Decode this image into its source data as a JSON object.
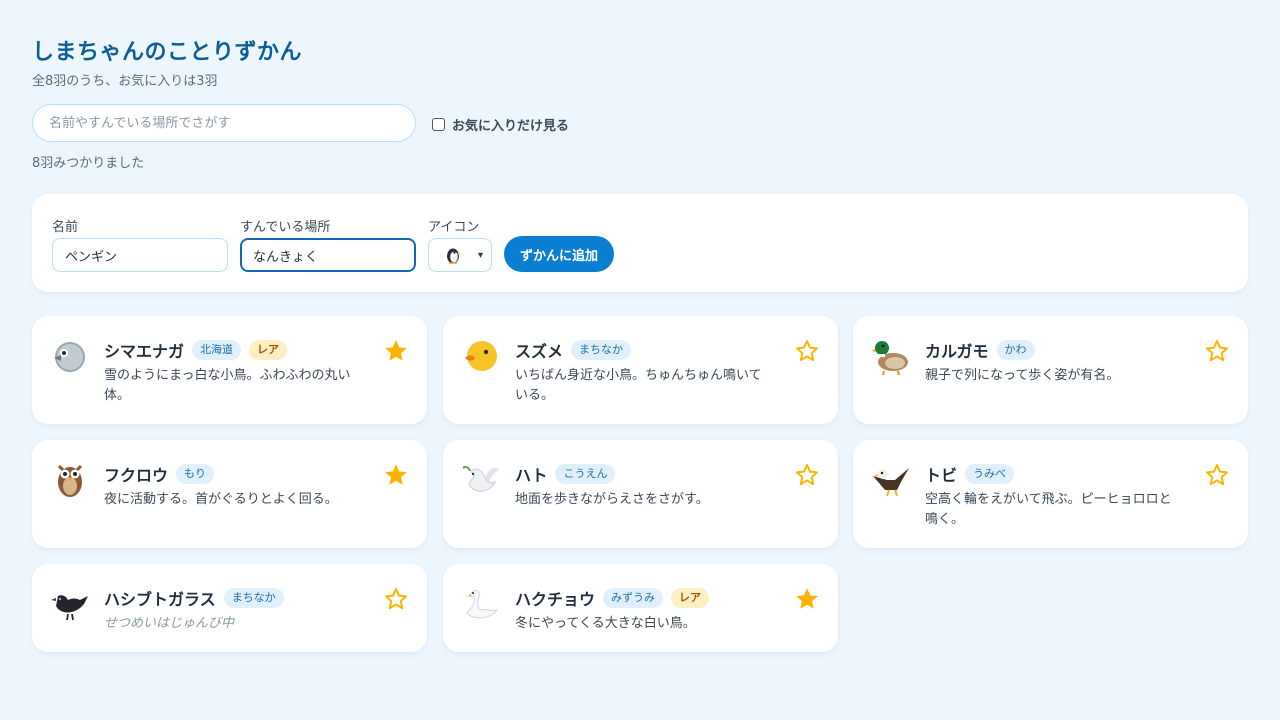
{
  "title": "しまちゃんのことりずかん",
  "subtitle": "全8羽のうち、お気に入りは3羽",
  "search": {
    "placeholder": "名前やすんでいる場所でさがす",
    "value": ""
  },
  "favorite_filter": {
    "label": "お気に入りだけ見る",
    "checked": false
  },
  "result_count": "8羽みつかりました",
  "form": {
    "name_label": "名前",
    "name_value": "ペンギン",
    "place_label": "すんでいる場所",
    "place_value": "なんきょく",
    "icon_label": "アイコン",
    "icon_selected": "penguin-icon",
    "add_button": "ずかんに追加"
  },
  "colors": {
    "accent": "#0a7fd1",
    "title": "#0b5f99",
    "star": "#ffb300",
    "background": "#eef6fd"
  },
  "cards": [
    {
      "icon": "bird-head-icon",
      "name": "シマエナガ",
      "place": "北海道",
      "rare": "レア",
      "desc": "雪のようにまっ白な小鳥。ふわふわの丸い体。",
      "favorite": true
    },
    {
      "icon": "chick-icon",
      "name": "スズメ",
      "place": "まちなか",
      "rare": "",
      "desc": "いちばん身近な小鳥。ちゅんちゅん鳴いている。",
      "favorite": false
    },
    {
      "icon": "duck-icon",
      "name": "カルガモ",
      "place": "かわ",
      "rare": "",
      "desc": "親子で列になって歩く姿が有名。",
      "favorite": false
    },
    {
      "icon": "owl-icon",
      "name": "フクロウ",
      "place": "もり",
      "rare": "",
      "desc": "夜に活動する。首がぐるりとよく回る。",
      "favorite": true
    },
    {
      "icon": "dove-icon",
      "name": "ハト",
      "place": "こうえん",
      "rare": "",
      "desc": "地面を歩きながらえさをさがす。",
      "favorite": false
    },
    {
      "icon": "eagle-icon",
      "name": "トビ",
      "place": "うみべ",
      "rare": "",
      "desc": "空高く輪をえがいて飛ぶ。ピーヒョロロと鳴く。",
      "favorite": false
    },
    {
      "icon": "black-bird-icon",
      "name": "ハシブトガラス",
      "place": "まちなか",
      "rare": "",
      "desc": "せつめいはじゅんび中",
      "favorite": false,
      "pending": true
    },
    {
      "icon": "swan-icon",
      "name": "ハクチョウ",
      "place": "みずうみ",
      "rare": "レア",
      "desc": "冬にやってくる大きな白い鳥。",
      "favorite": true
    }
  ]
}
